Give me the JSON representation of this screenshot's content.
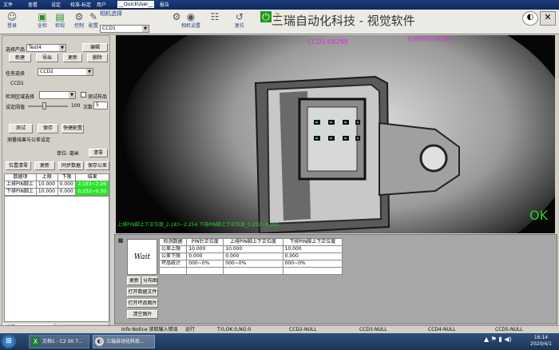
{
  "menu": {
    "items": [
      "文件",
      "查看",
      "设定",
      "校准-标定",
      "用户",
      "报告"
    ],
    "quick_user": "__QuickUser__"
  },
  "toolbar": {
    "buttons": [
      "登录",
      "全检",
      "检视",
      "控制",
      "配置",
      "相机设置",
      "复位"
    ],
    "camera_label": "相机选择",
    "camera_value": "CCD1",
    "reset_label": "复位"
  },
  "brand": "三瑞自动化科技 - 视觉软件",
  "left": {
    "product_label": "选择产品",
    "product_value": "Test4",
    "edit_btn": "编辑",
    "new_btn": "新建",
    "export_btn": "导出",
    "update_btn": "更新",
    "delete_btn": "删除",
    "task_label": "任务选择",
    "task_value": "CCD2",
    "ccd_tag": "CCD1",
    "region_label": "检测区域选择",
    "test_sample_label": "测试样品",
    "threshold_label": "设定阈值",
    "threshold_value": "100",
    "count_label": "次数",
    "count_value": "5",
    "test_btn": "测试",
    "save_btn": "保存",
    "quick_config_btn": "快捷配置",
    "result_section": "测量结果与公差设定",
    "unit_label": "单位: 毫米",
    "clear_btn": "清零",
    "clear_pos_btn": "位置清零",
    "update2_btn": "更新",
    "sync_btn": "同步数据",
    "save_tol_btn": "保存公差",
    "table_headers": [
      "数据项",
      "上限",
      "下限",
      "结果"
    ],
    "rows": [
      {
        "name": "上排PIN脚上",
        "upper": "10.000",
        "lower": "0.000",
        "result": "2.183~2.26"
      },
      {
        "name": "下排PIN脚上",
        "upper": "10.000",
        "lower": "0.000",
        "result": "0.232~0.30"
      }
    ],
    "bottom_tab1": "设置",
    "bottom_tab2": "运行"
  },
  "camera": {
    "ccd_name": "CCD1-08299",
    "time_label": "检测时间0.005秒",
    "measure_text": "上排PIN脚上下正位度_2.183~2.254 下排PIN脚上下正位度_0.232~0.301",
    "result": "OK"
  },
  "bottom": {
    "wait": "Wait",
    "update_btn": "更新",
    "distribute_btn": "分布图",
    "open_data_btn": "打开数据文件",
    "open_image_btn": "打开坏品图片",
    "clear_image_btn": "清空图片",
    "headers": [
      "检测数据",
      "PIN针正位度",
      "上排PIN脚上下正位度",
      "下排PIN脚上下正位度"
    ],
    "rows": [
      [
        "公差上限",
        "10.000",
        "10.000",
        "10.000"
      ],
      [
        "公差下限",
        "0.000",
        "0.000",
        "0.000"
      ],
      [
        "坏品统计",
        "000~0%",
        "000~0%",
        "000~0%"
      ]
    ]
  },
  "status": {
    "info": "Info:Notice 读取输入错误",
    "run": "运行",
    "counts": "T:0,OK:0,NG:0",
    "ccd2": "CCD2-NULL",
    "ccd3": "CCD3-NULL",
    "ccd4": "CCD4-NULL",
    "ccd5": "CCD5-NULL"
  },
  "taskbar": {
    "task1": "文档1 - C2 00 7...",
    "task2": "三瑞自动化科技...",
    "time": "16:14",
    "date": "2020/4/1"
  },
  "colors": {
    "menubar": "#1c3c7c",
    "ok_green": "#1ef01e",
    "magenta": "#d430d4",
    "measure_green": "#28d428"
  }
}
